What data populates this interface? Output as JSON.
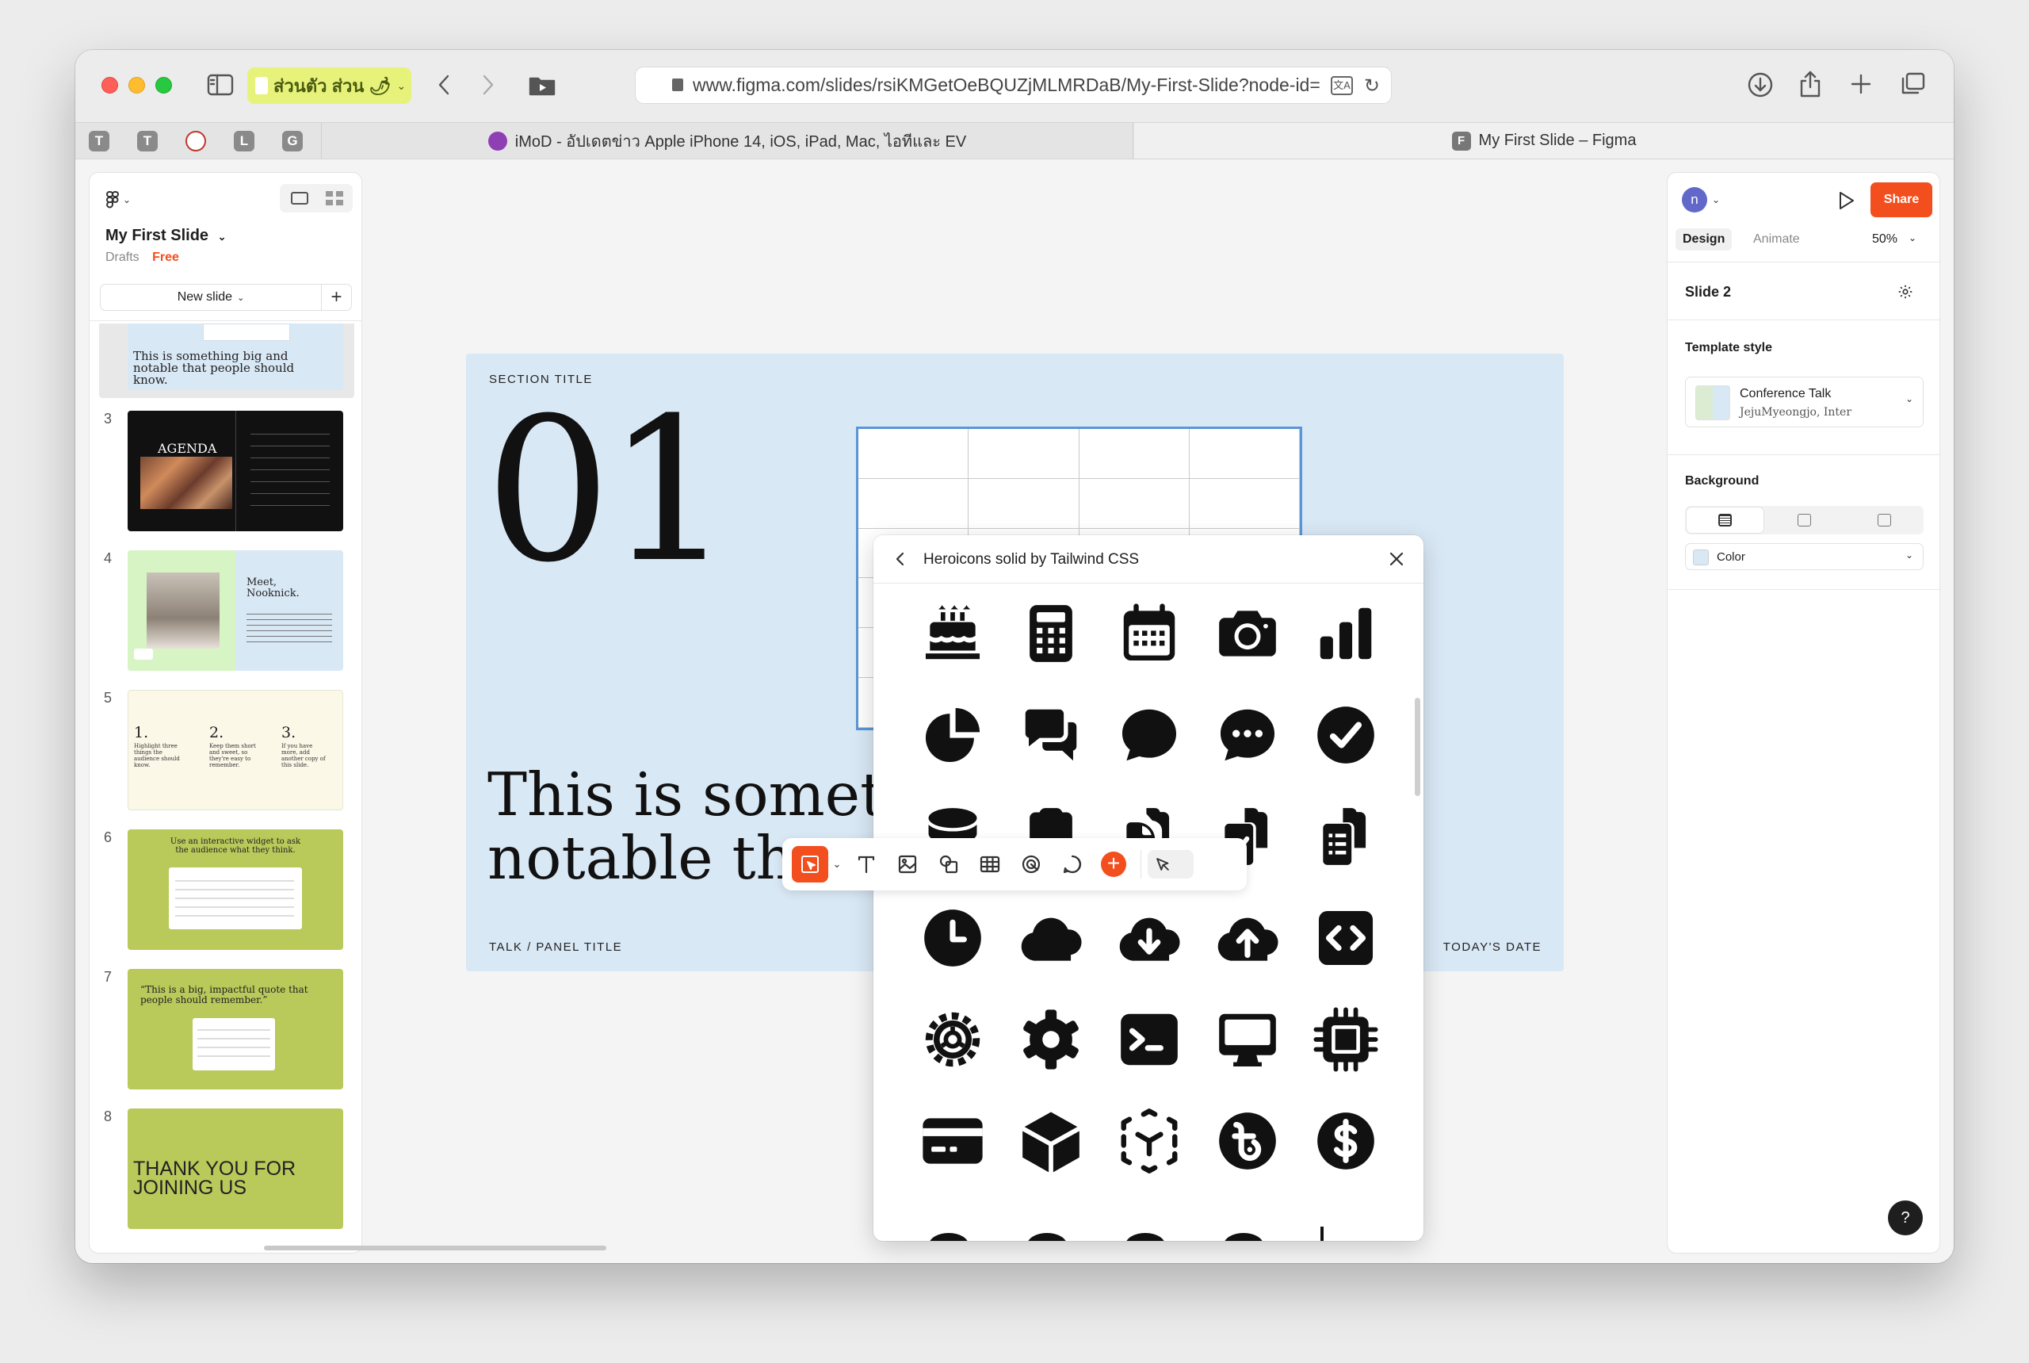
{
  "browser": {
    "profile_label": "ส่วนตัว ส่วน 🌶",
    "url": "www.figma.com/slides/rsiKMGetOeBQUZjMLMRDaB/My-First-Slide?node-id=",
    "pinned_tabs": [
      "T",
      "T",
      "",
      "L",
      "G"
    ],
    "tabs": [
      {
        "title": "iMoD - อัปเดตข่าว Apple iPhone 14, iOS, iPad, Mac, ไอทีและ EV"
      },
      {
        "title": "My First Slide – Figma",
        "favicon": "F"
      }
    ]
  },
  "left_panel": {
    "file_title": "My First Slide",
    "location": "Drafts",
    "plan_badge": "Free",
    "new_slide_label": "New slide",
    "slides": [
      {
        "number": "",
        "text": "This is something big and notable that people should know."
      },
      {
        "number": "3",
        "text": "AGENDA"
      },
      {
        "number": "4",
        "text": "Meet, Nooknick."
      },
      {
        "number": "5",
        "items": [
          "1.",
          "2.",
          "3."
        ],
        "subtexts": [
          "Highlight three things the audience should know.",
          "Keep them short and sweet, so they're easy to remember.",
          "If you have more, add another copy of this slide."
        ]
      },
      {
        "number": "6",
        "text": "Use an interactive widget to ask the audience what they think."
      },
      {
        "number": "7",
        "text": "“This is a big, impactful quote that people should remember.”"
      },
      {
        "number": "8",
        "text": "THANK YOU FOR JOINING US"
      }
    ]
  },
  "canvas": {
    "section_title": "SECTION TITLE",
    "big_number": "01",
    "statement_line1": "This is someth",
    "statement_line2": "notable that pe",
    "footer_left": "TALK / PANEL TITLE",
    "footer_right": "TODAY'S DATE"
  },
  "icon_picker": {
    "title": "Heroicons solid by Tailwind CSS",
    "icons": [
      "cake-icon",
      "calculator-icon",
      "calendar-days-icon",
      "camera-icon",
      "chart-bar-icon",
      "chart-pie-icon",
      "chat-bubble-left-right-icon",
      "chat-bubble-oval-left-icon",
      "chat-bubble-oval-left-ellipsis-icon",
      "check-circle-icon",
      "circle-stack-icon",
      "clipboard-icon",
      "clipboard-document-icon",
      "clipboard-document-check-icon",
      "clipboard-document-list-icon",
      "clock-icon",
      "cloud-icon",
      "cloud-arrow-down-icon",
      "cloud-arrow-up-icon",
      "code-bracket-square-icon",
      "cog-icon",
      "cog-6-tooth-icon",
      "command-line-icon",
      "computer-desktop-icon",
      "cpu-chip-icon",
      "credit-card-icon",
      "cube-icon",
      "cube-transparent-icon",
      "currency-bangladeshi-icon",
      "currency-dollar-icon"
    ]
  },
  "right_panel": {
    "avatar_initial": "n",
    "share_label": "Share",
    "tabs": [
      "Design",
      "Animate"
    ],
    "zoom": "50%",
    "slide_name": "Slide 2",
    "template_style_heading": "Template style",
    "template_name": "Conference Talk",
    "template_fonts": "JejuMyeongjo, Inter",
    "background_heading": "Background",
    "background_fill": "Color",
    "help_label": "?"
  },
  "colors": {
    "accent": "#f24e1e",
    "slide_bg": "#d9e8f5",
    "selection": "#5a96d6",
    "thumb_green": "#b9c95a"
  }
}
